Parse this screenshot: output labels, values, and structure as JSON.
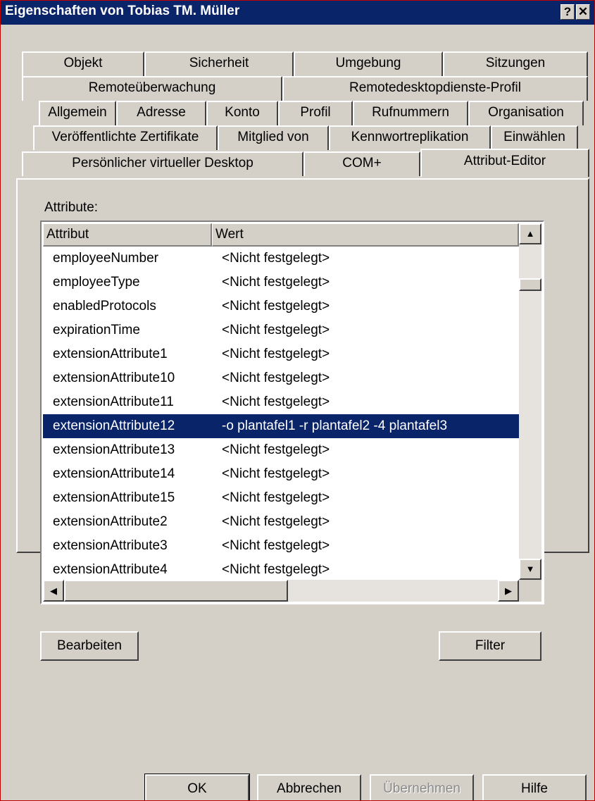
{
  "window": {
    "title": "Eigenschaften von Tobias TM. Müller",
    "help_glyph": "?",
    "close_glyph": "✕"
  },
  "tabs": {
    "row1": [
      "Objekt",
      "Sicherheit",
      "Umgebung",
      "Sitzungen"
    ],
    "row2": [
      "Remoteüberwachung",
      "Remotedesktopdienste-Profil"
    ],
    "row3": [
      "Allgemein",
      "Adresse",
      "Konto",
      "Profil",
      "Rufnummern",
      "Organisation"
    ],
    "row4": [
      "Veröffentlichte Zertifikate",
      "Mitglied von",
      "Kennwortreplikation",
      "Einwählen"
    ],
    "row5": [
      "Persönlicher virtueller Desktop",
      "COM+",
      "Attribut-Editor"
    ],
    "active": "Attribut-Editor"
  },
  "attributes_label": "Attribute:",
  "list": {
    "columns": [
      "Attribut",
      "Wert"
    ],
    "rows": [
      {
        "attr": "employeeNumber",
        "value": "<Nicht festgelegt>"
      },
      {
        "attr": "employeeType",
        "value": "<Nicht festgelegt>"
      },
      {
        "attr": "enabledProtocols",
        "value": "<Nicht festgelegt>"
      },
      {
        "attr": "expirationTime",
        "value": "<Nicht festgelegt>"
      },
      {
        "attr": "extensionAttribute1",
        "value": "<Nicht festgelegt>"
      },
      {
        "attr": "extensionAttribute10",
        "value": "<Nicht festgelegt>"
      },
      {
        "attr": "extensionAttribute11",
        "value": "<Nicht festgelegt>"
      },
      {
        "attr": "extensionAttribute12",
        "value": "-o plantafel1 -r plantafel2 -4 plantafel3",
        "selected": true
      },
      {
        "attr": "extensionAttribute13",
        "value": "<Nicht festgelegt>"
      },
      {
        "attr": "extensionAttribute14",
        "value": "<Nicht festgelegt>"
      },
      {
        "attr": "extensionAttribute15",
        "value": "<Nicht festgelegt>"
      },
      {
        "attr": "extensionAttribute2",
        "value": "<Nicht festgelegt>"
      },
      {
        "attr": "extensionAttribute3",
        "value": "<Nicht festgelegt>"
      },
      {
        "attr": "extensionAttribute4",
        "value": "<Nicht festgelegt>"
      }
    ]
  },
  "buttons": {
    "edit": "Bearbeiten",
    "filter": "Filter",
    "ok": "OK",
    "cancel": "Abbrechen",
    "apply": "Übernehmen",
    "help": "Hilfe"
  },
  "colors": {
    "selection": "#0a246a",
    "titlebar": "#0a246a",
    "dialog_face": "#d4d0c8",
    "window_border": "#c00000"
  }
}
